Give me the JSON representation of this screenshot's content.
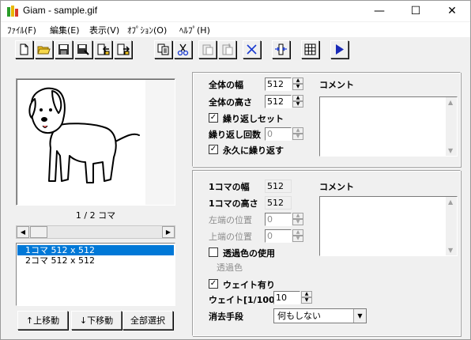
{
  "window": {
    "title": "Giam - sample.gif"
  },
  "title_buttons": {
    "minimize": "—",
    "maximize": "☐",
    "close": "✕"
  },
  "menu": {
    "items": [
      "ﾌｧｲﾙ(F)",
      "編集(E)",
      "表示(V)",
      "ｵﾌﾟｼｮﾝ(O)",
      "ﾍﾙﾌﾟ(H)"
    ]
  },
  "toolbar": {
    "buttons": [
      "new-file-icon",
      "open-folder-icon",
      "save-icon",
      "save-as-icon",
      "import-icon",
      "export-icon",
      "copy-icon",
      "cut-icon",
      "paste-icon",
      "paste-insert-icon",
      "delete-icon",
      "fit-icon",
      "grid-icon",
      "play-icon"
    ]
  },
  "preview": {
    "frame_label": "1 / 2 コマ"
  },
  "frame_list": {
    "items": [
      "1コマ 512 x 512",
      "2コマ 512 x 512"
    ],
    "selected_index": 0
  },
  "buttons": {
    "move_up": "↑上移動",
    "move_down": "↓下移動",
    "select_all": "全部選択"
  },
  "global": {
    "width_label": "全体の幅",
    "width_value": "512",
    "height_label": "全体の高さ",
    "height_value": "512",
    "loop_set_label": "繰り返しセット",
    "loop_set_checked": true,
    "loop_count_label": "繰り返し回数",
    "loop_count_value": "0",
    "loop_forever_label": "永久に繰り返す",
    "loop_forever_checked": true,
    "comment_label": "コメント",
    "comment_value": ""
  },
  "frame": {
    "width_label": "1コマの幅",
    "width_value": "512",
    "height_label": "1コマの高さ",
    "height_value": "512",
    "left_label": "左端の位置",
    "left_value": "0",
    "top_label": "上端の位置",
    "top_value": "0",
    "transparent_label": "透過色の使用",
    "transparent_checked": false,
    "transparent_color_label": "透過色",
    "wait_label": "ウェイト有り",
    "wait_checked": true,
    "wait_value_label": "ウェイト[1/100s]",
    "wait_value": "10",
    "dispose_label": "消去手段",
    "dispose_value": "何もしない",
    "comment_label": "コメント",
    "comment_value": ""
  }
}
